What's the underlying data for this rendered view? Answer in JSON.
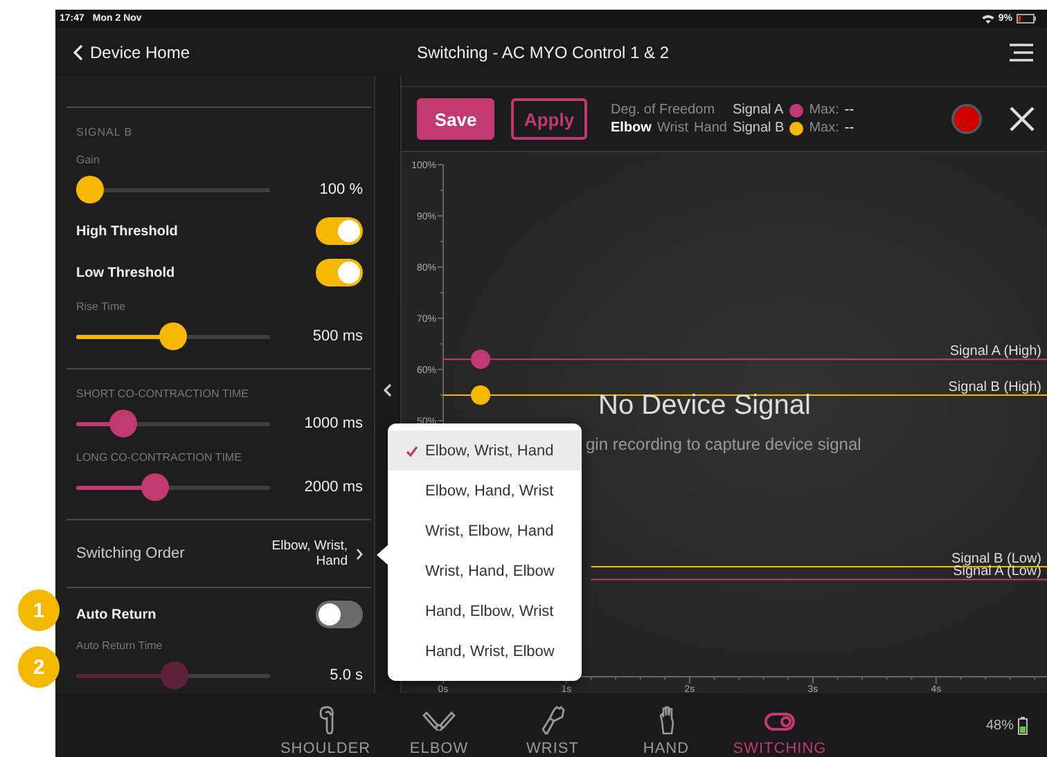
{
  "callouts": [
    "1",
    "2"
  ],
  "status_bar": {
    "time": "17:47",
    "date": "Mon 2 Nov",
    "battery": "9%"
  },
  "nav": {
    "back": "Device Home",
    "title": "Switching - AC MYO Control 1 & 2"
  },
  "settings": {
    "groups": [
      {
        "heading": "SIGNAL B",
        "rows": [
          {
            "kind": "slider",
            "label": "Gain",
            "level": 0.07,
            "value": "100 %",
            "color": "#f7b900"
          },
          {
            "kind": "toggle",
            "label": "High Threshold",
            "on": true
          },
          {
            "kind": "toggle",
            "label": "Low Threshold",
            "on": true
          },
          {
            "kind": "slider",
            "label": "Rise Time",
            "level": 0.5,
            "value": "500 ms",
            "color": "#f7b900"
          }
        ]
      },
      {
        "rows": [
          {
            "kind": "slider",
            "label": "SHORT CO-CONTRACTION TIME",
            "level": 0.24,
            "value": "1000 ms",
            "color": "#c2396f"
          },
          {
            "kind": "slider",
            "label": "LONG CO-CONTRACTION TIME",
            "level": 0.41,
            "value": "2000 ms",
            "color": "#c2396f"
          }
        ]
      },
      {
        "rows": [
          {
            "kind": "select",
            "label": "Switching Order",
            "value": "Elbow, Wrist, Hand"
          }
        ]
      },
      {
        "rows": [
          {
            "kind": "toggle",
            "label": "Auto Return",
            "on": false
          },
          {
            "kind": "slider",
            "label": "Auto Return Time",
            "level": 0.51,
            "value": "5.0 s",
            "color": "#5e2139"
          }
        ]
      }
    ]
  },
  "toolbar": {
    "buttons": [
      {
        "label": "Save",
        "kind": "filled"
      },
      {
        "label": "Apply",
        "kind": "outline"
      }
    ],
    "dof_label": "Deg. of Freedom",
    "dof_options": [
      {
        "label": "Elbow",
        "selected": true
      },
      {
        "label": "Wrist",
        "selected": false
      },
      {
        "label": "Hand",
        "selected": false
      }
    ],
    "signals": [
      {
        "name": "Signal A",
        "color": "#c2396f",
        "max_label": "Max:",
        "max": "--"
      },
      {
        "name": "Signal B",
        "color": "#f7b900",
        "max_label": "Max:",
        "max": "--"
      }
    ]
  },
  "chart": {
    "message": "No Device Signal",
    "hint": "gin recording to capture device signal",
    "handles": [
      {
        "color": "#c2396f"
      },
      {
        "color": "#f7b900"
      }
    ],
    "chart_data": {
      "type": "line",
      "x": [
        0,
        1.2,
        4.9
      ],
      "xlim": [
        0,
        4.9
      ],
      "ylim": [
        0,
        100
      ],
      "series": [
        {
          "name": "Signal A (High)",
          "color": "#c2396f",
          "values": [
            62,
            62,
            62
          ]
        },
        {
          "name": "Signal B (High)",
          "color": "#f7b900",
          "values": [
            55,
            55,
            55
          ]
        },
        {
          "name": "Signal B (Low)",
          "color": "#f7b900",
          "values": [
            null,
            21.5,
            21.5
          ]
        },
        {
          "name": "Signal A (Low)",
          "color": "#c2396f",
          "values": [
            null,
            19,
            19
          ]
        }
      ],
      "xticks": [
        {
          "value": 0,
          "label": "0s"
        },
        {
          "value": 1,
          "label": "1s"
        },
        {
          "value": 2,
          "label": "2s"
        },
        {
          "value": 3,
          "label": "3s"
        },
        {
          "value": 4,
          "label": "4s"
        }
      ],
      "yticks": [
        {
          "value": 50,
          "label": "50%"
        },
        {
          "value": 60,
          "label": "60%"
        },
        {
          "value": 70,
          "label": "70%"
        },
        {
          "value": 80,
          "label": "80%"
        },
        {
          "value": 90,
          "label": "90%"
        },
        {
          "value": 100,
          "label": "100%"
        }
      ]
    }
  },
  "popup": {
    "options": [
      {
        "label": "Elbow, Wrist, Hand",
        "selected": true
      },
      {
        "label": "Elbow, Hand, Wrist",
        "selected": false
      },
      {
        "label": "Wrist, Elbow, Hand",
        "selected": false
      },
      {
        "label": "Wrist, Hand, Elbow",
        "selected": false
      },
      {
        "label": "Hand, Elbow, Wrist",
        "selected": false
      },
      {
        "label": "Hand, Wrist, Elbow",
        "selected": false
      }
    ]
  },
  "tabs": [
    {
      "label": "SHOULDER",
      "selected": false
    },
    {
      "label": "ELBOW",
      "selected": false
    },
    {
      "label": "WRIST",
      "selected": false
    },
    {
      "label": "HAND",
      "selected": false
    },
    {
      "label": "SWITCHING",
      "selected": true
    }
  ],
  "battery": "48%"
}
